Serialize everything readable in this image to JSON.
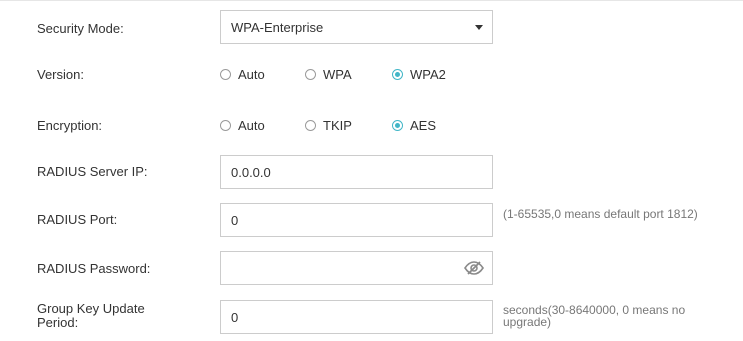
{
  "security_mode": {
    "label": "Security Mode:",
    "value": "WPA-Enterprise"
  },
  "version": {
    "label": "Version:",
    "options": [
      "Auto",
      "WPA",
      "WPA2"
    ],
    "selected": "WPA2"
  },
  "encryption": {
    "label": "Encryption:",
    "options": [
      "Auto",
      "TKIP",
      "AES"
    ],
    "selected": "AES"
  },
  "radius_server_ip": {
    "label": "RADIUS Server IP:",
    "value": "0.0.0.0"
  },
  "radius_port": {
    "label": "RADIUS Port:",
    "value": "0",
    "hint": "(1-65535,0 means default port 1812)"
  },
  "radius_password": {
    "label": "RADIUS Password:",
    "value": "",
    "icon": "eye-off-icon"
  },
  "group_key_update": {
    "label": "Group Key Update Period:",
    "value": "0",
    "hint": "seconds(30-8640000, 0 means no upgrade)"
  },
  "colors": {
    "accent": "#41b6c7",
    "border": "#cccccc",
    "text": "#333333",
    "hint": "#777777"
  }
}
